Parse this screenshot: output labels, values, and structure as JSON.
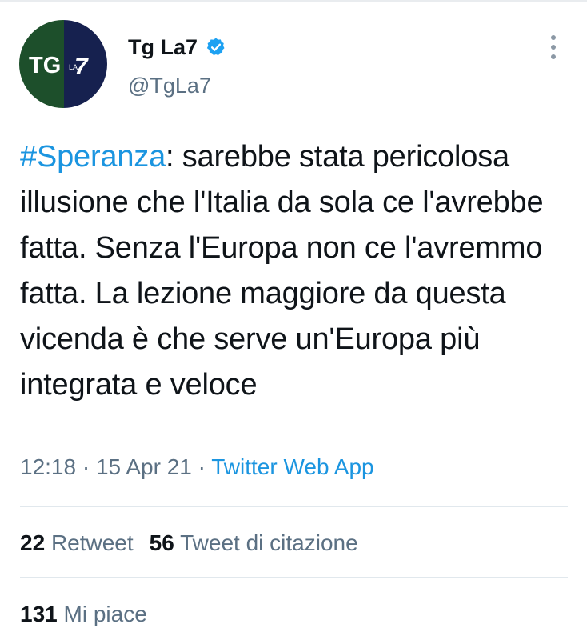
{
  "tweet": {
    "author": {
      "display_name": "Tg La7",
      "handle": "@TgLa7",
      "verified": true,
      "avatar": {
        "text_main": "TG",
        "text_small": "LA",
        "text_seven": "7",
        "colors": {
          "left": "#1d4f2b",
          "right": "#16214f",
          "text": "#ffffff"
        }
      }
    },
    "more_icon": "more-vertical-icon",
    "text": {
      "hashtag": "#Speranza",
      "body": ": sarebbe stata pericolosa illusione che l'Italia da sola ce l'avrebbe fatta. Senza l'Europa non ce l'avremmo fatta. La lezione maggiore da questa vicenda è che serve un'Europa più integrata e veloce"
    },
    "meta": {
      "time": "12:18",
      "separator": " · ",
      "date": "15 Apr 21",
      "source": "Twitter Web App"
    },
    "stats": {
      "retweets": {
        "count": "22",
        "label": "Retweet"
      },
      "quote_tweets": {
        "count": "56",
        "label": "Tweet di citazione"
      },
      "likes": {
        "count": "131",
        "label": "Mi piace"
      }
    },
    "colors": {
      "link": "#1b95e0",
      "text": "#0f1419",
      "secondary": "#5b7083",
      "verified": "#1da1f2",
      "divider": "#e1e8ed"
    }
  }
}
